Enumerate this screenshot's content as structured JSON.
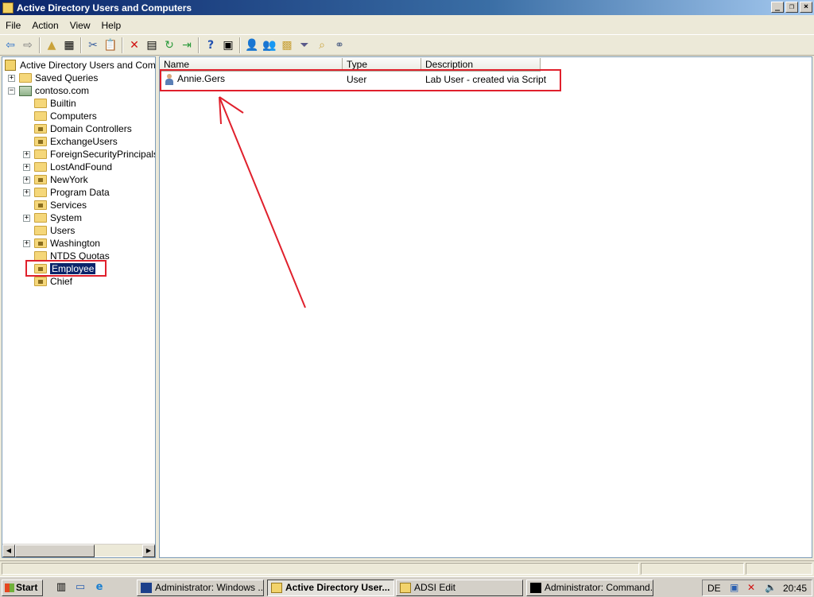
{
  "window": {
    "title": "Active Directory Users and Computers"
  },
  "menu": [
    "File",
    "Action",
    "View",
    "Help"
  ],
  "tree": {
    "root": "Active Directory Users and Comput",
    "saved_queries": "Saved Queries",
    "domain": "contoso.com",
    "children": [
      "Builtin",
      "Computers",
      "Domain Controllers",
      "ExchangeUsers",
      "ForeignSecurityPrincipals",
      "LostAndFound",
      "NewYork",
      "Program Data",
      "Services",
      "System",
      "Users",
      "Washington",
      "NTDS Quotas",
      "Employee",
      "Chief"
    ]
  },
  "list": {
    "columns": [
      "Name",
      "Type",
      "Description"
    ],
    "rows": [
      {
        "name": "Annie.Gers",
        "type": "User",
        "description": "Lab User - created via Script"
      }
    ]
  },
  "taskbar": {
    "start": "Start",
    "tasks": [
      "Administrator: Windows ...",
      "Active Directory User...",
      "ADSI Edit",
      "Administrator: Command..."
    ],
    "lang": "DE",
    "clock": "20:45"
  },
  "colors": {
    "annotation": "#e0202c",
    "selection": "#0a246a"
  }
}
